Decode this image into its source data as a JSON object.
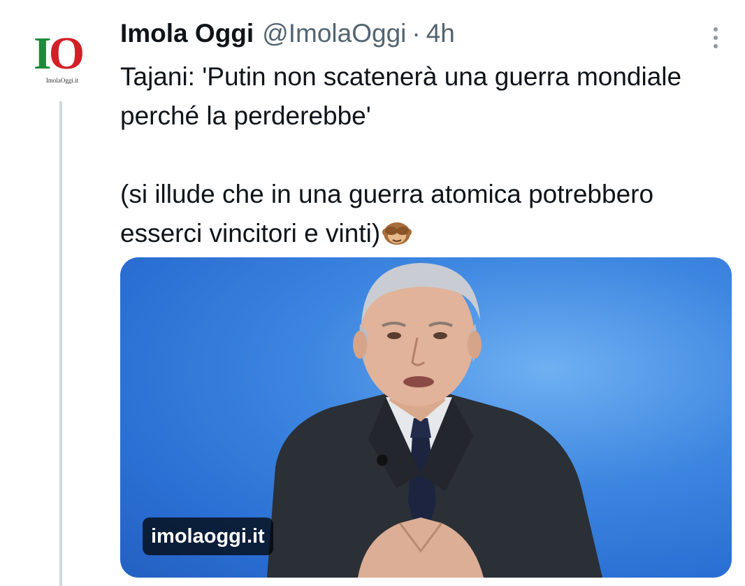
{
  "tweet": {
    "author_name": "Imola Oggi",
    "author_handle": "@ImolaOggi",
    "separator": "·",
    "time": "4h",
    "text_line1": "Tajani: 'Putin non scatenerà una guerra mondiale perché la perderebbe'",
    "text_line2": "(si illude che in una guerra atomica potrebbero esserci vincitori e vinti)",
    "emoji": "see-no-evil-monkey",
    "media_domain": "imolaoggi.it"
  },
  "avatar": {
    "logo_letter_1": "I",
    "logo_letter_2": "O",
    "logo_subtext": "ImolaOggi.it"
  },
  "icons": {
    "more": "more-vertical-icon"
  },
  "colors": {
    "text": "#0f1419",
    "secondary": "#536471",
    "thread_line": "#cfd9de",
    "logo_green": "#1e8a3a",
    "logo_red": "#d21f26",
    "photo_bg": "#3d86e0"
  }
}
